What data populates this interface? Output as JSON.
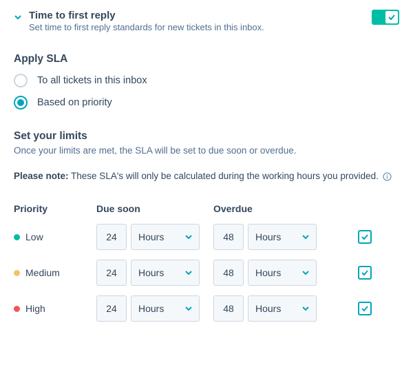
{
  "header": {
    "title": "Time to first reply",
    "subtitle": "Set time to first reply standards for new tickets in this inbox."
  },
  "applySLA": {
    "title": "Apply SLA",
    "options": {
      "all": "To all tickets in this inbox",
      "priority": "Based on priority"
    }
  },
  "limits": {
    "title": "Set your limits",
    "desc": "Once your limits are met, the SLA will be set to due soon or overdue.",
    "note_label": "Please note:",
    "note_text": " These SLA's will only be calculated during the working hours you provided."
  },
  "table": {
    "headers": {
      "priority": "Priority",
      "due_soon": "Due soon",
      "overdue": "Overdue"
    },
    "rows": [
      {
        "priority": "Low",
        "due_value": "24",
        "due_unit": "Hours",
        "over_value": "48",
        "over_unit": "Hours"
      },
      {
        "priority": "Medium",
        "due_value": "24",
        "due_unit": "Hours",
        "over_value": "48",
        "over_unit": "Hours"
      },
      {
        "priority": "High",
        "due_value": "24",
        "due_unit": "Hours",
        "over_value": "48",
        "over_unit": "Hours"
      }
    ]
  }
}
